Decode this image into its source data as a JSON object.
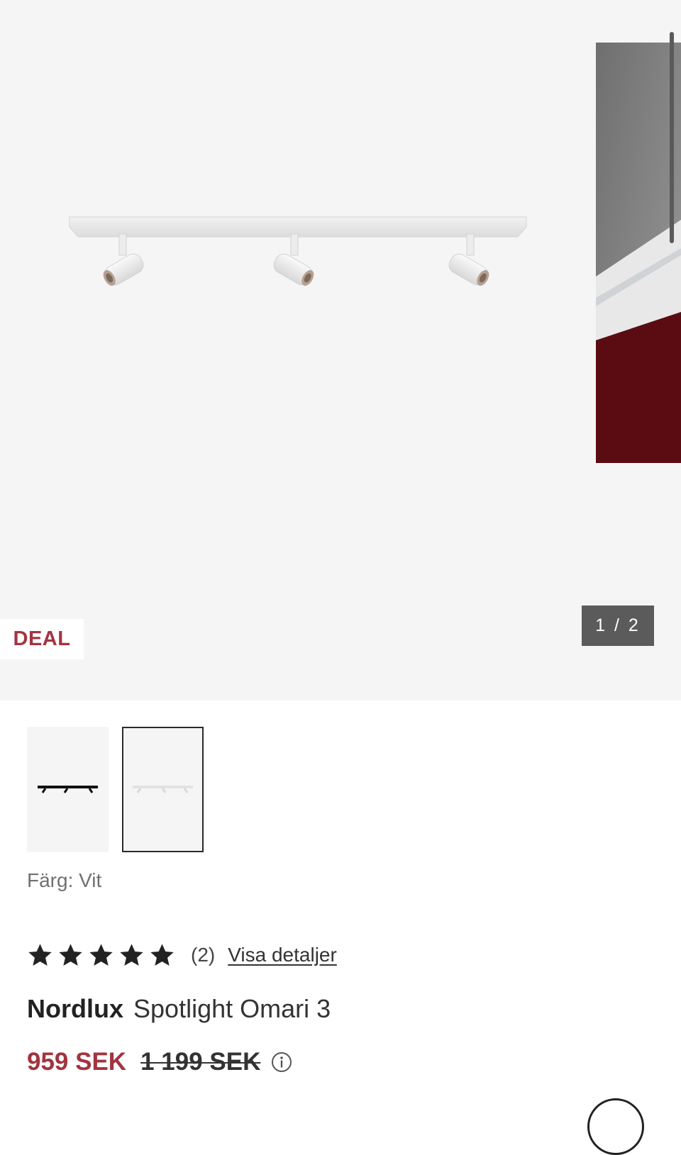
{
  "gallery": {
    "badge": "DEAL",
    "counter": "1 / 2",
    "main_image_icon": "spotlight-bar-white-image",
    "next_image_icon": "room-photo-image"
  },
  "thumbnails": [
    {
      "name": "thumbnail-black",
      "color": "#111111",
      "selected": false
    },
    {
      "name": "thumbnail-white",
      "color": "#e6e6e6",
      "selected": true
    }
  ],
  "variant": {
    "color_label": "Färg: Vit"
  },
  "rating": {
    "stars": 5,
    "count_text": "(2)",
    "details_link": "Visa detaljer"
  },
  "product": {
    "brand": "Nordlux",
    "name": "Spotlight Omari 3"
  },
  "price": {
    "sale": "959 SEK",
    "original": "1 199 SEK"
  },
  "colors": {
    "accent": "#a3343f",
    "counter_bg": "#5b5b5b",
    "gallery_bg": "#f5f5f5"
  }
}
